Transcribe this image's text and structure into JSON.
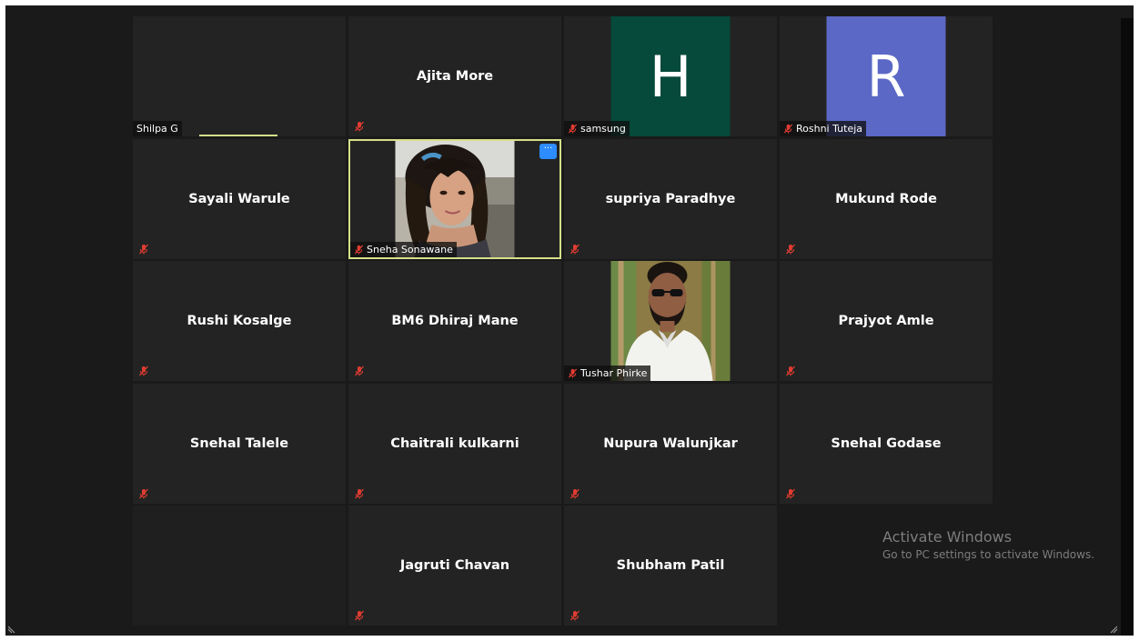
{
  "participants": [
    {
      "name": "Shilpa G",
      "display": "label",
      "speaking": true
    },
    {
      "name": "Ajita More",
      "display": "name",
      "muted": true
    },
    {
      "name": "samsung",
      "display": "avatar",
      "initial": "H",
      "avatar_color": "#054a3a",
      "muted": true
    },
    {
      "name": "Roshni Tuteja",
      "display": "avatar",
      "initial": "R",
      "avatar_color": "#5b68c6",
      "muted": true
    },
    {
      "name": "Sayali Warule",
      "display": "name",
      "muted": true
    },
    {
      "name": "Sneha Sonawane",
      "display": "photo",
      "muted": true,
      "active": true,
      "more_label": "···"
    },
    {
      "name": "supriya Paradhye",
      "display": "name",
      "muted": true
    },
    {
      "name": "Mukund Rode",
      "display": "name",
      "muted": true
    },
    {
      "name": "Rushi Kosalge",
      "display": "name",
      "muted": true
    },
    {
      "name": "BM6 Dhiraj Mane",
      "display": "name",
      "muted": true
    },
    {
      "name": "Tushar Phirke",
      "display": "photo",
      "muted": true
    },
    {
      "name": "Prajyot Amle",
      "display": "name",
      "muted": true
    },
    {
      "name": "Snehal Talele",
      "display": "name",
      "muted": true
    },
    {
      "name": "Chaitrali kulkarni",
      "display": "name",
      "muted": true
    },
    {
      "name": "Nupura Walunjkar",
      "display": "name",
      "muted": true
    },
    {
      "name": "Snehal Godase",
      "display": "name",
      "muted": true
    },
    {
      "name": "Jagruti Chavan",
      "display": "name",
      "muted": true
    },
    {
      "name": "Shubham Patil",
      "display": "name",
      "muted": true
    }
  ],
  "watermark": {
    "title": "Activate Windows",
    "subtitle": "Go to PC settings to activate Windows."
  },
  "colors": {
    "tile_bg": "#232323",
    "active_border": "#d6e08a",
    "mute_red": "#e03c31",
    "more_button": "#2d8cff"
  },
  "icons": {
    "mute": "microphone-muted-icon",
    "more": "more-options-icon",
    "resize": "resize-grip-icon"
  }
}
